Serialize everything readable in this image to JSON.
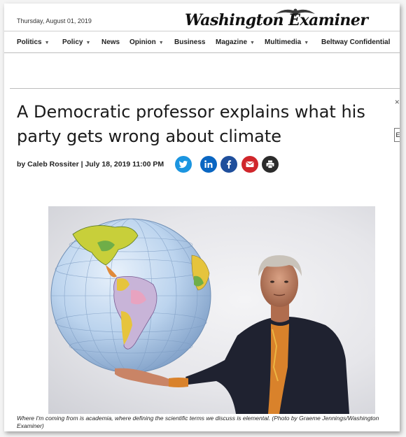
{
  "header": {
    "date": "Thursday, August 01, 2019",
    "logo_text": "Washington Examiner"
  },
  "nav": {
    "items": [
      {
        "label": "Politics",
        "has_menu": true
      },
      {
        "label": "Policy",
        "has_menu": true
      },
      {
        "label": "News",
        "has_menu": false
      },
      {
        "label": "Opinion",
        "has_menu": true
      },
      {
        "label": "Business",
        "has_menu": false
      },
      {
        "label": "Magazine",
        "has_menu": true
      },
      {
        "label": "Multimedia",
        "has_menu": true
      },
      {
        "label": "Beltway Confidential",
        "has_menu": false
      }
    ]
  },
  "article": {
    "headline": "A Democratic professor explains what his party gets wrong about climate",
    "byline": "by Caleb Rossiter | July 18, 2019 11:00 PM",
    "share_buttons": [
      {
        "name": "twitter",
        "icon": "twitter-icon",
        "color": "#1b95e0"
      },
      {
        "name": "linkedin",
        "icon": "linkedin-icon",
        "color": "#0a66c2"
      },
      {
        "name": "facebook",
        "icon": "facebook-icon",
        "color": "#1f4f9c"
      },
      {
        "name": "email",
        "icon": "mail-icon",
        "color": "#d0262b"
      },
      {
        "name": "print",
        "icon": "print-icon",
        "color": "#2b2b2b"
      }
    ],
    "caption": "Where I'm coming from is academia, where defining the scientific terms we discuss is elemental. (Photo by Graeme Jennings/Washington Examiner)"
  },
  "colors": {
    "nav_text": "#222222",
    "divider": "#bdbdbd",
    "headline": "#1a1a1a"
  }
}
